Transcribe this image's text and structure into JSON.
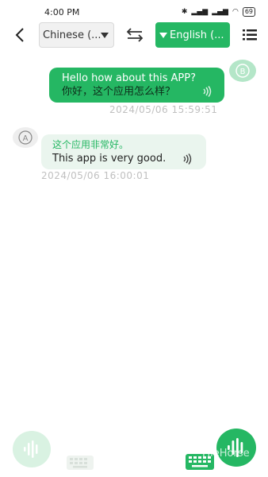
{
  "status_bar": {
    "time": "4:00 PM",
    "battery": "69"
  },
  "toolbar": {
    "source_language": "Chinese (...",
    "target_language": "English (..."
  },
  "messages": [
    {
      "direction": "outgoing",
      "original": "Hello how about this APP?",
      "translation": "你好，这个应用怎么样？",
      "timestamp": "2024/05/06 15:59:51"
    },
    {
      "direction": "incoming",
      "original": "这个应用非常好。",
      "translation": "This app is very good.",
      "timestamp": "2024/05/06 16:00:01"
    }
  ],
  "watermark": "FileHorse",
  "colors": {
    "accent": "#25b763",
    "accent_light": "#d9f2e2",
    "bubble_incoming": "#eaf5ee",
    "timestamp": "#c0c0c0"
  },
  "icons": [
    "back-arrow-icon",
    "swap-icon",
    "menu-icon",
    "speaker-icon",
    "avatar-icon",
    "microphone-icon",
    "keyboard-icon"
  ]
}
